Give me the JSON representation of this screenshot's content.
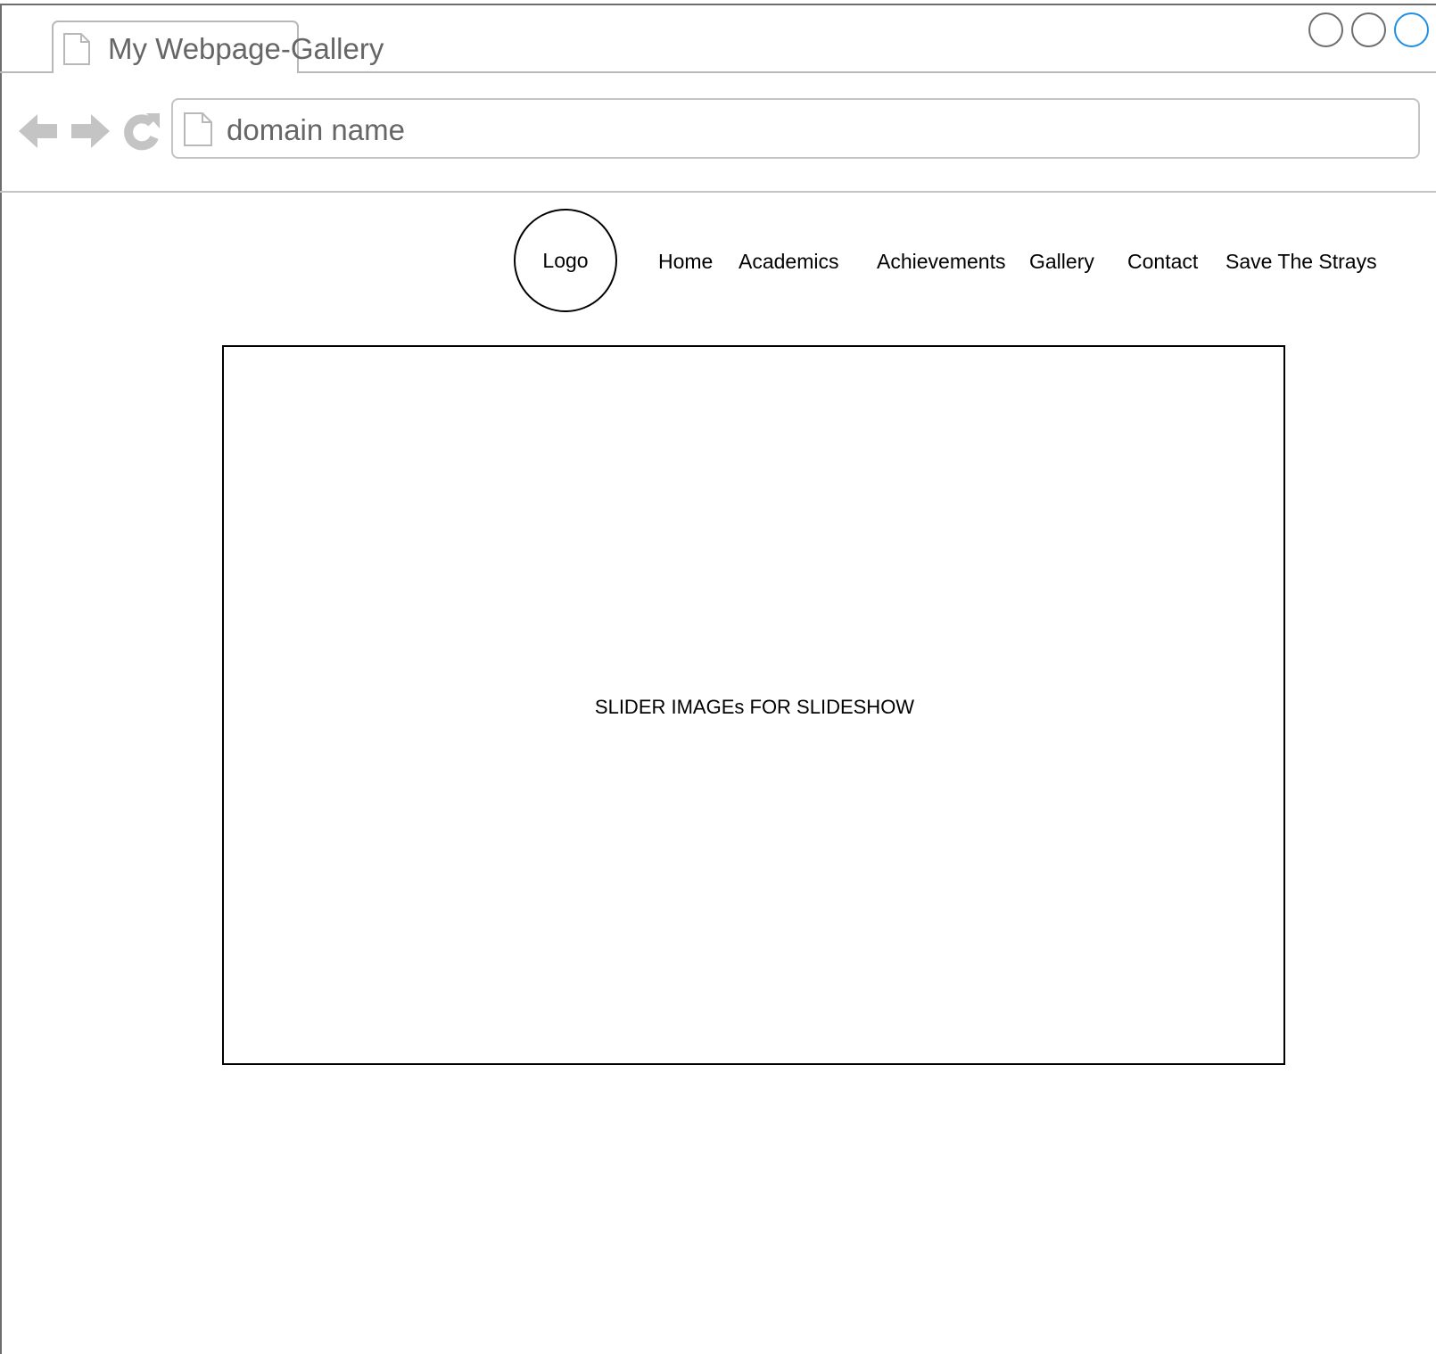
{
  "browser": {
    "tab_title": "My Webpage-Gallery",
    "address": "domain name",
    "icons": {
      "tab": "document-icon",
      "back": "back-arrow-icon",
      "forward": "forward-arrow-icon",
      "reload": "reload-icon",
      "address": "document-icon"
    },
    "window_button_accent": "#1e8fe6"
  },
  "site": {
    "logo": "Logo",
    "nav": {
      "home": "Home",
      "academics": "Academics",
      "achievements": "Achievements",
      "gallery": "Gallery",
      "contact": "Contact",
      "save_the_strays": "Save The Strays"
    },
    "slider_text": "SLIDER IMAGEs FOR SLIDESHOW"
  }
}
